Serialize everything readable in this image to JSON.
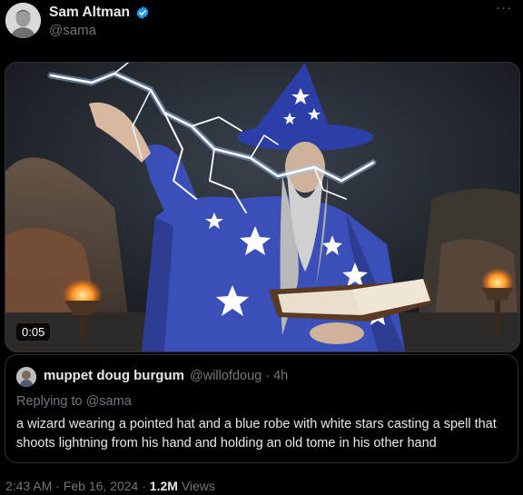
{
  "tweet": {
    "author": {
      "name": "Sam Altman",
      "handle": "@sama"
    },
    "video": {
      "duration": "0:05"
    },
    "quote": {
      "author": "muppet doug burgum",
      "handle": "@willofdoug",
      "time": "4h",
      "replying_prefix": "Replying to ",
      "replying_mention": "@sama",
      "text": "a wizard wearing a pointed hat and a blue robe with white stars casting a spell that shoots lightning from his hand and holding an old tome in his other hand"
    },
    "meta": {
      "time": "2:43 AM",
      "date": "Feb 16, 2024",
      "views_count": "1.2M",
      "views_label": "Views"
    }
  },
  "colors": {
    "verified": "#1d9bf0",
    "robe": "#3a4fb8",
    "background": "#000000"
  }
}
